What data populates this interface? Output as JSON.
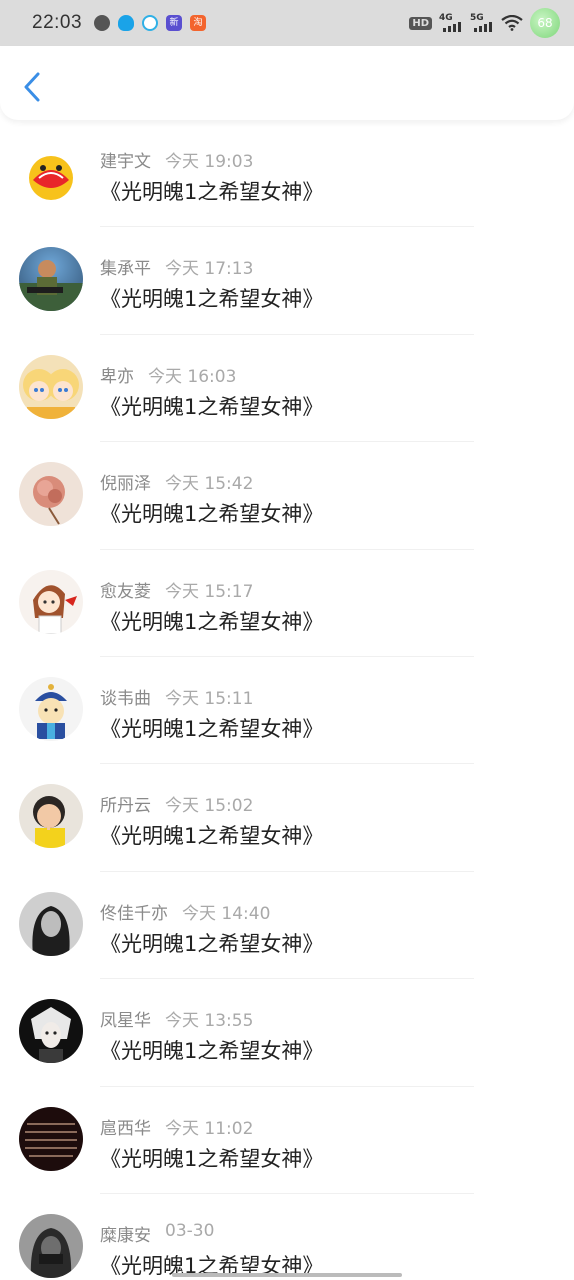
{
  "status_bar": {
    "time": "22:03",
    "hd_label": "HD",
    "net1": "4G",
    "net2": "5G",
    "battery": "68"
  },
  "header": {
    "back_icon": "chevron-left-icon",
    "accent": "#3a8ee6"
  },
  "items": [
    {
      "name": "建宇文",
      "time": "今天 19:03",
      "content": "《光明魄1之希望女神》"
    },
    {
      "name": "集承平",
      "time": "今天 17:13",
      "content": "《光明魄1之希望女神》"
    },
    {
      "name": "卑亦",
      "time": "今天 16:03",
      "content": "《光明魄1之希望女神》"
    },
    {
      "name": "倪丽泽",
      "time": "今天 15:42",
      "content": "《光明魄1之希望女神》"
    },
    {
      "name": "愈友菱",
      "time": "今天 15:17",
      "content": "《光明魄1之希望女神》"
    },
    {
      "name": "谈韦曲",
      "time": "今天 15:11",
      "content": "《光明魄1之希望女神》"
    },
    {
      "name": "所丹云",
      "time": "今天 15:02",
      "content": "《光明魄1之希望女神》"
    },
    {
      "name": "佟佳千亦",
      "time": "今天 14:40",
      "content": "《光明魄1之希望女神》"
    },
    {
      "name": "凤星华",
      "time": "今天 13:55",
      "content": "《光明魄1之希望女神》"
    },
    {
      "name": "扈西华",
      "time": "今天 11:02",
      "content": "《光明魄1之希望女神》"
    },
    {
      "name": "糜康安",
      "time": "03-30",
      "content": "《光明魄1之希望女神》"
    }
  ]
}
